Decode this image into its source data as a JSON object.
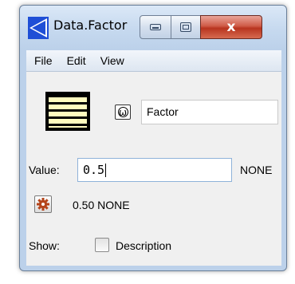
{
  "window": {
    "title": "Data.Factor",
    "close_glyph": "x"
  },
  "menu": {
    "items": [
      {
        "label": "File"
      },
      {
        "label": "Edit"
      },
      {
        "label": "View"
      }
    ]
  },
  "object": {
    "icon": "table-grid-icon",
    "omega_glyph": "ω",
    "name": "Factor"
  },
  "value": {
    "label": "Value:",
    "input": "0.5",
    "unit": "NONE"
  },
  "evaluation": {
    "icon": "gear-icon",
    "result": "0.50 NONE"
  },
  "show": {
    "label": "Show:",
    "description_label": "Description",
    "description_checked": false
  }
}
